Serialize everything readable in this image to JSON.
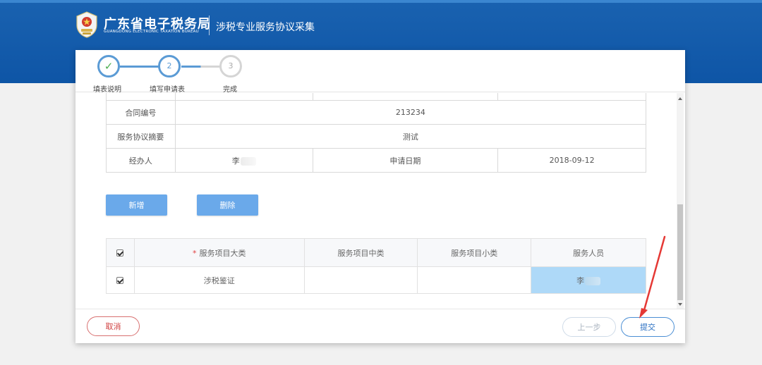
{
  "header": {
    "org_name_cn": "广东省电子税务局",
    "org_name_en": "GUANGDONG ELECTRONIC TAXATION BUREAU",
    "page_title": "涉税专业服务协议采集"
  },
  "steps": [
    {
      "number": "✓",
      "label": "填表说明",
      "state": "done"
    },
    {
      "number": "2",
      "label": "填写申请表",
      "state": "current"
    },
    {
      "number": "3",
      "label": "完成",
      "state": "pending"
    }
  ],
  "info_table": {
    "contract_no_label": "合同编号",
    "contract_no_value": "213234",
    "summary_label": "服务协议摘要",
    "summary_value": "测试",
    "handler_label": "经办人",
    "handler_value": "李",
    "apply_date_label": "申请日期",
    "apply_date_value": "2018-09-12"
  },
  "actions": {
    "add_label": "新增",
    "delete_label": "删除"
  },
  "service_table": {
    "headers": {
      "category_major": "服务项目大类",
      "category_middle": "服务项目中类",
      "category_minor": "服务项目小类",
      "staff": "服务人员"
    },
    "required_mark": "*",
    "rows": [
      {
        "checked": true,
        "category_major": "涉税鉴证",
        "category_middle": "",
        "category_minor": "",
        "staff": "李"
      }
    ]
  },
  "footer": {
    "cancel_label": "取消",
    "prev_label": "上一步",
    "submit_label": "提交"
  },
  "colors": {
    "banner": "#0e55a6",
    "accent": "#6aa9ea",
    "highlight_cell": "#aed9f8",
    "arrow": "#e53935"
  }
}
